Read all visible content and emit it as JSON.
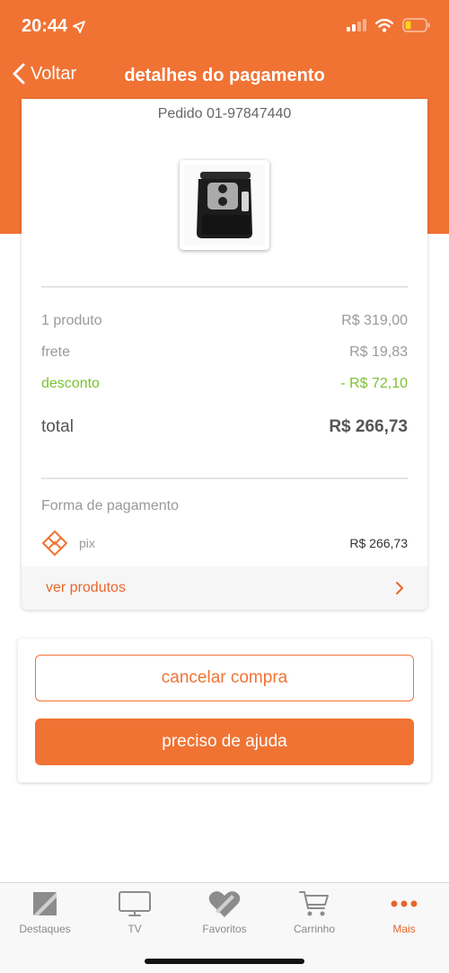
{
  "status_bar": {
    "time": "20:44",
    "icons": [
      "location-arrow-icon",
      "signal-icon",
      "wifi-icon",
      "battery-low-icon"
    ]
  },
  "nav": {
    "back_label": "Voltar",
    "title": "detalhes do pagamento"
  },
  "order": {
    "id_label": "Pedido 01-97847440",
    "product_image": "air-fryer-image"
  },
  "summary": {
    "products_label": "1 produto",
    "products_value": "R$ 319,00",
    "shipping_label": "frete",
    "shipping_value": "R$ 19,83",
    "discount_label": "desconto",
    "discount_value": "- R$ 72,10",
    "total_label": "total",
    "total_value": "R$ 266,73"
  },
  "payment": {
    "section_label": "Forma de pagamento",
    "method": "pix",
    "method_icon": "pix-icon",
    "amount": "R$ 266,73"
  },
  "see_products": {
    "label": "ver produtos",
    "icon": "chevron-right-icon"
  },
  "actions": {
    "cancel_label": "cancelar compra",
    "help_label": "preciso de ajuda"
  },
  "tabs": [
    {
      "label": "Destaques",
      "icon": "highlights-icon",
      "active": false
    },
    {
      "label": "TV",
      "icon": "tv-icon",
      "active": false
    },
    {
      "label": "Favoritos",
      "icon": "heart-icon",
      "active": false
    },
    {
      "label": "Carrinho",
      "icon": "cart-icon",
      "active": false
    },
    {
      "label": "Mais",
      "icon": "more-icon",
      "active": true
    }
  ],
  "colors": {
    "brand_orange": "#f07334",
    "discount_green": "#7cc22f"
  }
}
